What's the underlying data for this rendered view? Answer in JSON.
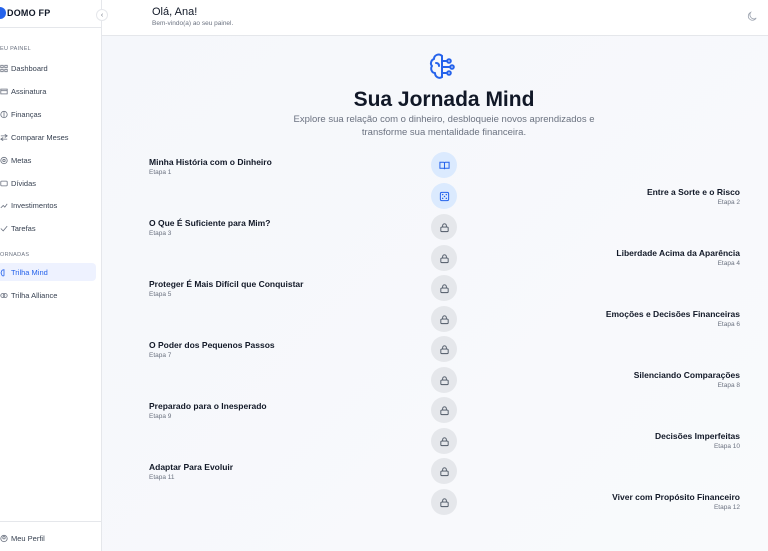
{
  "sidebar": {
    "brand": "DOMO FP",
    "section_painel": "EU PAINEL",
    "section_jornadas": "ORNADAS",
    "items": [
      {
        "label": "Dashboard",
        "icon": "grid-icon"
      },
      {
        "label": "Assinatura",
        "icon": "card-icon"
      },
      {
        "label": "Finanças",
        "icon": "dollar-icon"
      },
      {
        "label": "Comparar Meses",
        "icon": "compare-icon"
      },
      {
        "label": "Metas",
        "icon": "target-icon"
      },
      {
        "label": "Dívidas",
        "icon": "debt-icon"
      },
      {
        "label": "Investimentos",
        "icon": "chart-icon"
      },
      {
        "label": "Tarefas",
        "icon": "check-icon"
      }
    ],
    "journeys": [
      {
        "label": "Trilha Mind",
        "icon": "brain-icon",
        "active": true
      },
      {
        "label": "Trilha Alliance",
        "icon": "link-icon",
        "active": false
      }
    ],
    "profile": "Meu Perfil"
  },
  "header": {
    "greeting": "Olá, Ana!",
    "subtitle": "Bem-vindo(a) ao seu painel."
  },
  "main": {
    "title": "Sua Jornada Mind",
    "subtitle": "Explore sua relação com o dinheiro, desbloqueie novos aprendizados e transforme sua mentalidade financeira.",
    "steps": [
      {
        "title": "Minha História com o Dinheiro",
        "stage": "Etapa 1",
        "side": "left",
        "status": "unlocked",
        "icon": "book-icon"
      },
      {
        "title": "Entre a Sorte e o Risco",
        "stage": "Etapa 2",
        "side": "right",
        "status": "unlocked",
        "icon": "dice-icon"
      },
      {
        "title": "O Que É Suficiente para Mim?",
        "stage": "Etapa 3",
        "side": "left",
        "status": "locked",
        "icon": "lock-icon"
      },
      {
        "title": "Liberdade Acima da Aparência",
        "stage": "Etapa 4",
        "side": "right",
        "status": "locked",
        "icon": "lock-icon"
      },
      {
        "title": "Proteger É Mais Difícil que Conquistar",
        "stage": "Etapa 5",
        "side": "left",
        "status": "locked",
        "icon": "lock-icon"
      },
      {
        "title": "Emoções e Decisões Financeiras",
        "stage": "Etapa 6",
        "side": "right",
        "status": "locked",
        "icon": "lock-icon"
      },
      {
        "title": "O Poder dos Pequenos Passos",
        "stage": "Etapa 7",
        "side": "left",
        "status": "locked",
        "icon": "lock-icon"
      },
      {
        "title": "Silenciando Comparações",
        "stage": "Etapa 8",
        "side": "right",
        "status": "locked",
        "icon": "lock-icon"
      },
      {
        "title": "Preparado para o Inesperado",
        "stage": "Etapa 9",
        "side": "left",
        "status": "locked",
        "icon": "lock-icon"
      },
      {
        "title": "Decisões Imperfeitas",
        "stage": "Etapa 10",
        "side": "right",
        "status": "locked",
        "icon": "lock-icon"
      },
      {
        "title": "Adaptar Para Evoluir",
        "stage": "Etapa 11",
        "side": "left",
        "status": "locked",
        "icon": "lock-icon"
      },
      {
        "title": "Viver com Propósito Financeiro",
        "stage": "Etapa 12",
        "side": "right",
        "status": "locked",
        "icon": "lock-icon"
      }
    ]
  },
  "colors": {
    "accent": "#2563eb",
    "node_unlocked": "#dbeafe",
    "node_locked": "#e5e7eb"
  }
}
